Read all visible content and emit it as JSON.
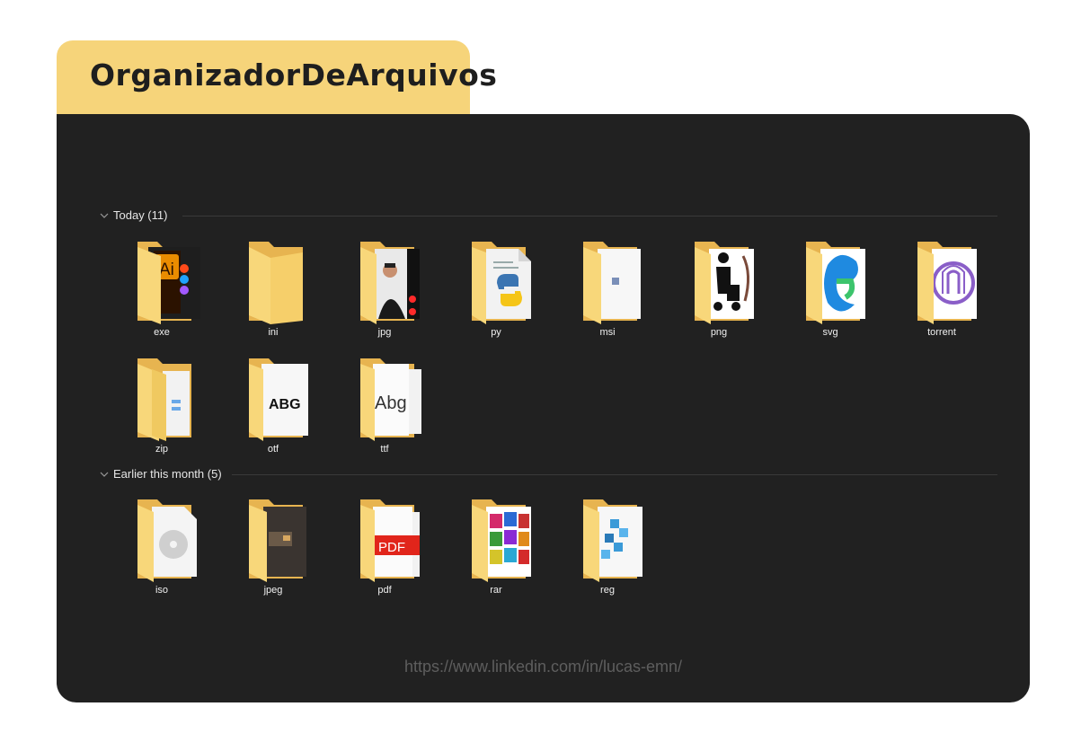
{
  "app": {
    "title": "OrganizadorDeArquivos"
  },
  "groups": [
    {
      "label": "Today (11)"
    },
    {
      "label": "Earlier this month (5)"
    }
  ],
  "files": {
    "exe": "exe",
    "ini": "ini",
    "jpg": "jpg",
    "py": "py",
    "msi": "msi",
    "png": "png",
    "svg": "svg",
    "torrent": "torrent",
    "zip": "zip",
    "otf": "otf",
    "ttf": "ttf",
    "iso": "iso",
    "jpeg": "jpeg",
    "pdf": "pdf",
    "rar": "rar",
    "reg": "reg"
  },
  "thumbs": {
    "ai": "Ai",
    "font": "ABG",
    "ttf": "Abg",
    "pdf": "PDF"
  },
  "footer": {
    "link": "https://www.linkedin.com/in/lucas-emn/"
  },
  "colors": {
    "accent": "#f6d47a",
    "window_bg": "#212121",
    "folder": "#f3c96b"
  }
}
